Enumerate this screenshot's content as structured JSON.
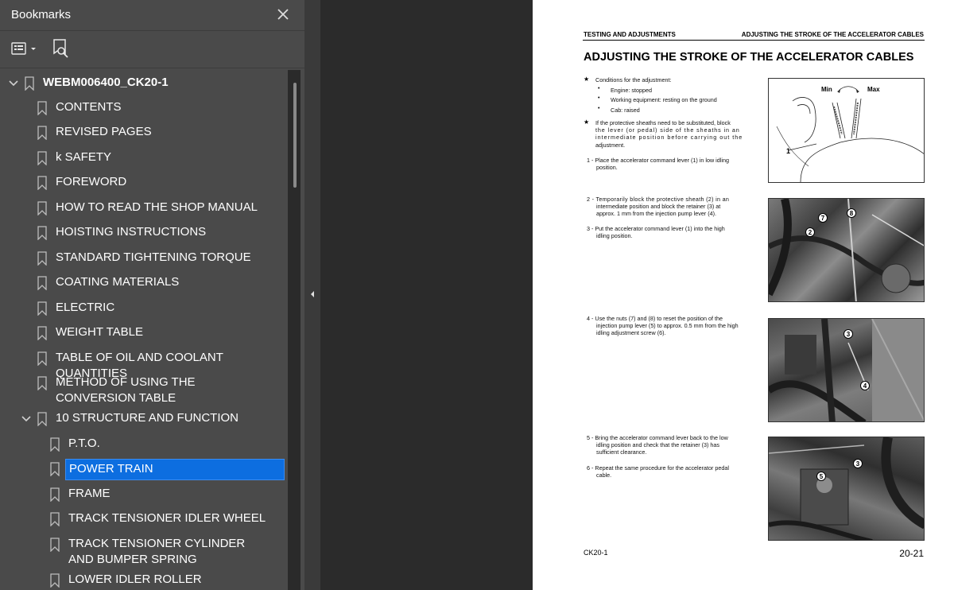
{
  "sidebar": {
    "title": "Bookmarks",
    "items": [
      {
        "label": "WEBM006400_CK20-1"
      },
      {
        "label": "CONTENTS"
      },
      {
        "label": "REVISED PAGES"
      },
      {
        "label": "k SAFETY"
      },
      {
        "label": "FOREWORD"
      },
      {
        "label": "HOW TO READ THE SHOP MANUAL"
      },
      {
        "label": "HOISTING INSTRUCTIONS"
      },
      {
        "label": "STANDARD TIGHTENING TORQUE"
      },
      {
        "label": "COATING MATERIALS"
      },
      {
        "label": "ELECTRIC"
      },
      {
        "label": "WEIGHT TABLE"
      },
      {
        "label": "TABLE OF OIL AND COOLANT QUANTITIES"
      },
      {
        "label": "METHOD OF USING THE CONVERSION TABLE"
      },
      {
        "label": "10 STRUCTURE AND FUNCTION"
      },
      {
        "label": "P.T.O."
      },
      {
        "label": "POWER TRAIN"
      },
      {
        "label": "FRAME"
      },
      {
        "label": "TRACK TENSIONER IDLER WHEEL"
      },
      {
        "label": "TRACK TENSIONER CYLINDER AND BUMPER SPRING"
      },
      {
        "label": "LOWER IDLER ROLLER"
      }
    ]
  },
  "page": {
    "header_left": "TESTING AND ADJUSTMENTS",
    "header_right": "ADJUSTING THE STROKE OF THE ACCELERATOR CABLES",
    "title": "ADJUSTING THE STROKE OF THE ACCELERATOR CABLES",
    "conditions_title": "Conditions for the adjustment:",
    "cond1": "Engine: stopped",
    "cond2": "Working equipment: resting on the ground",
    "cond3": "Cab: raised",
    "sheath_note_1": "If the protective sheaths need to be substituted, block",
    "sheath_note_2": "the lever (or pedal) side of the sheaths in an",
    "sheath_note_3": "intermediate position before carrying out the",
    "sheath_note_4": "adjustment.",
    "step1_a": "1 - Place the accelerator command lever (1) in low idling",
    "step1_b": "position.",
    "step2_a": "2 - Temporarily block the protective sheath (2) in an",
    "step2_b": "intermediate position and block the retainer (3) at",
    "step2_c": "approx. 1 mm from the injection pump lever (4).",
    "step3_a": "3 - Put the accelerator command lever (1) into the high",
    "step3_b": "idling position.",
    "step4_a": "4 - Use the nuts (7) and (8) to reset the position of the",
    "step4_b": "injection pump lever (5) to approx. 0.5 mm from the high",
    "step4_c": "idling adjustment screw (6).",
    "step5_a": "5 - Bring the accelerator command lever back to the low",
    "step5_b": "idling position and check that the retainer (3) has",
    "step5_c": "sufficient clearance.",
    "step6_a": "6 - Repeat the same procedure for the accelerator pedal",
    "step6_b": "cable.",
    "fig1_min": "Min",
    "fig1_max": "Max",
    "fig1_callout": "1",
    "fig2_c1": "2",
    "fig2_c2": "7",
    "fig2_c3": "8",
    "fig3_c1": "3",
    "fig3_c2": "4",
    "fig4_c1": "3",
    "fig4_c2": "5",
    "footer_left": "CK20-1",
    "footer_right": "20-21"
  },
  "colors": {
    "sidebar_bg": "#4a4a4a",
    "selection": "#0d6ee0",
    "viewer_bg": "#2b2b2b"
  }
}
